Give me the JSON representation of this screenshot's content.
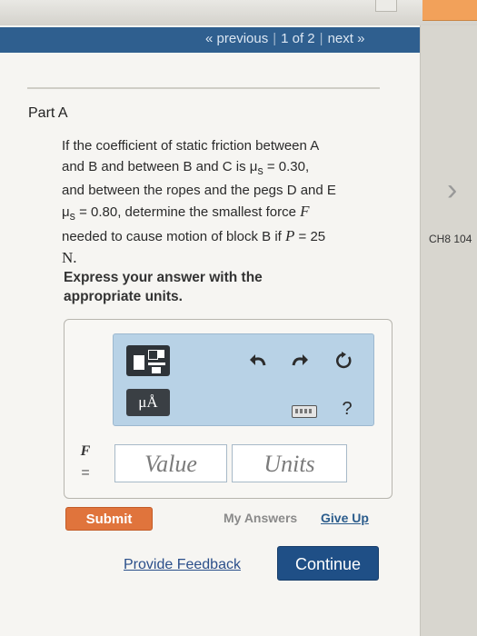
{
  "pager": {
    "previous": "« previous",
    "position": "1 of 2",
    "next": "next »"
  },
  "part": {
    "title": "Part A"
  },
  "problem": {
    "l1": "If the coefficient of static friction between A",
    "l2a": "and B and between B and C is μ",
    "l2sub": "s",
    "l2b": " = 0.30,",
    "l3": "and between the ropes and the pegs D and E",
    "l4a": "μ",
    "l4sub": "s",
    "l4b": " = 0.80, determine the smallest force ",
    "l4var": "F",
    "l5a": "needed to cause motion of block B if ",
    "l5var": "P",
    "l5b": " = 25",
    "l6": "N."
  },
  "instructions": "Express your answer with the appropriate units.",
  "toolbar": {
    "units_label": "μÅ",
    "undo_icon": "undo-icon",
    "redo_icon": "redo-icon",
    "reset_icon": "reset-icon",
    "keyboard_icon": "keyboard-icon",
    "help_label": "?"
  },
  "answer": {
    "variable": "F",
    "equals": "=",
    "value_placeholder": "Value",
    "units_placeholder": "Units"
  },
  "actions": {
    "submit": "Submit",
    "my_answers": "My Answers",
    "give_up": "Give Up",
    "feedback": "Provide Feedback",
    "continue": "Continue"
  },
  "side": {
    "label": "CH8 104"
  },
  "colors": {
    "pager_bg": "#2f5f8f",
    "submit": "#e0743c",
    "continue": "#1f4f86",
    "toolbar": "#b8d2e6"
  }
}
